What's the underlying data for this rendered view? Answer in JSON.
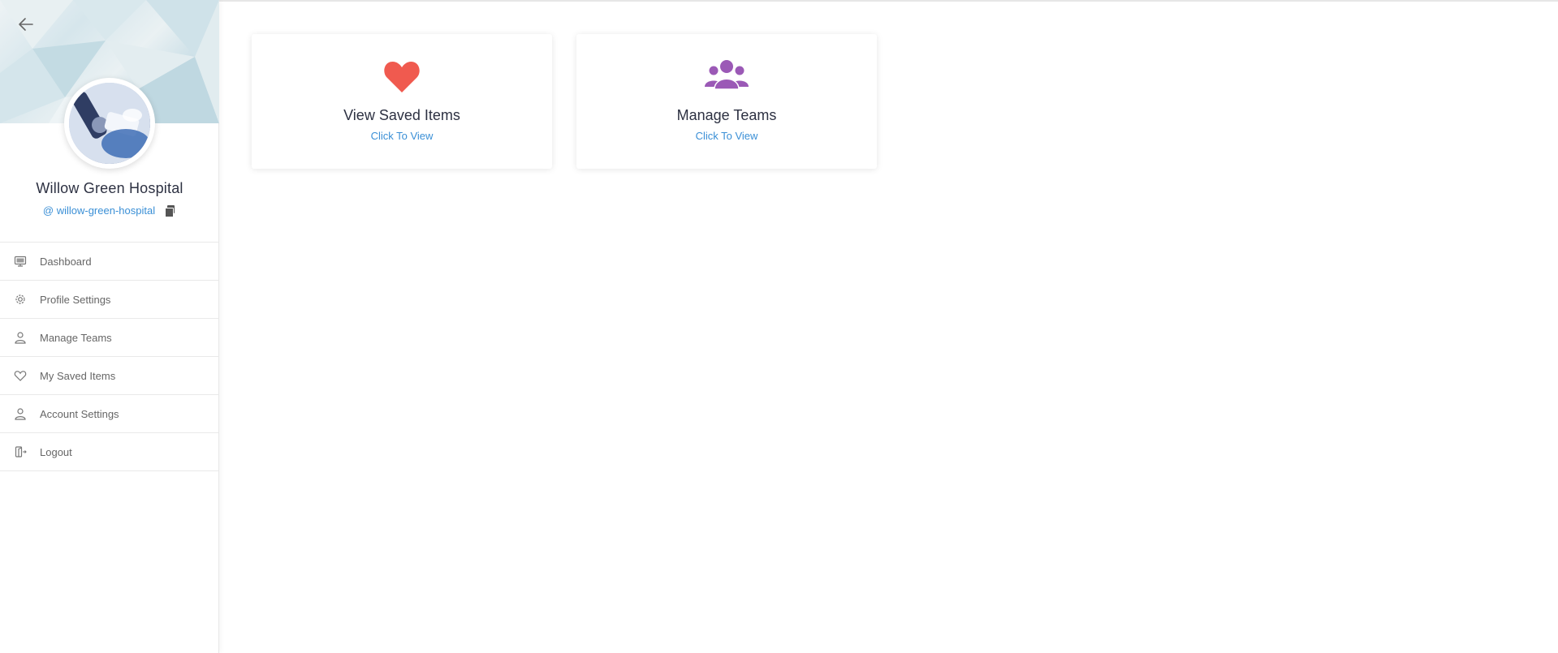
{
  "sidebar": {
    "back_icon": "arrow-left-icon",
    "org_name": "Willow Green Hospital",
    "handle": "@ willow-green-hospital",
    "copy_icon": "copy-icon",
    "menu": [
      {
        "label": "Dashboard",
        "icon": "monitor-icon"
      },
      {
        "label": "Profile Settings",
        "icon": "gear-icon"
      },
      {
        "label": "Manage Teams",
        "icon": "user-icon"
      },
      {
        "label": "My Saved Items",
        "icon": "heart-outline-icon"
      },
      {
        "label": "Account Settings",
        "icon": "user-icon"
      },
      {
        "label": "Logout",
        "icon": "logout-icon"
      }
    ]
  },
  "cards": [
    {
      "title": "View Saved Items",
      "link": "Click To View",
      "icon": "heart-icon",
      "icon_color": "#f05a4f"
    },
    {
      "title": "Manage Teams",
      "link": "Click To View",
      "icon": "users-icon",
      "icon_color": "#9b59b6"
    }
  ],
  "colors": {
    "link": "#3a8fd6",
    "text_dark": "#2d3142",
    "menu_text": "#666666"
  }
}
